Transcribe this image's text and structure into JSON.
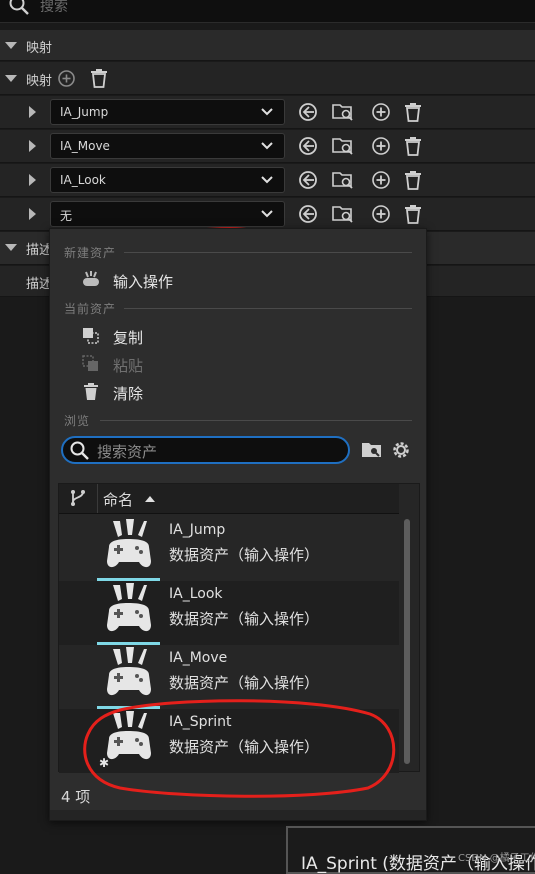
{
  "top_search": {
    "placeholder": "搜索"
  },
  "section_mapping": {
    "label": "映射"
  },
  "mapping_sub": {
    "label": "映射"
  },
  "mappings": [
    {
      "value": "IA_Jump"
    },
    {
      "value": "IA_Move"
    },
    {
      "value": "IA_Look"
    },
    {
      "value": "无"
    }
  ],
  "description_row": {
    "label": "描述"
  },
  "description_sub": {
    "label": "描述"
  },
  "popup": {
    "new_asset_header": "新建资产",
    "new_asset_item": "输入操作",
    "current_asset_header": "当前资产",
    "copy": "复制",
    "paste": "粘贴",
    "clear": "清除",
    "browse_header": "浏览",
    "search_placeholder": "搜索资产",
    "column_name": "命名",
    "assets": [
      {
        "name": "IA_Jump",
        "type": "数据资产（输入操作）"
      },
      {
        "name": "IA_Look",
        "type": "数据资产（输入操作）"
      },
      {
        "name": "IA_Move",
        "type": "数据资产（输入操作）"
      },
      {
        "name": "IA_Sprint",
        "type": "数据资产（输入操作）"
      }
    ],
    "count": "4 项"
  },
  "tooltip": {
    "text": "IA_Sprint (数据资产（输入操作"
  },
  "colors": {
    "annotation_red": "#e4201b",
    "focus_blue": "#1f6fc1",
    "thumb_accent": "#7fd8e6"
  },
  "watermark": "CSDN @橘子工作室"
}
